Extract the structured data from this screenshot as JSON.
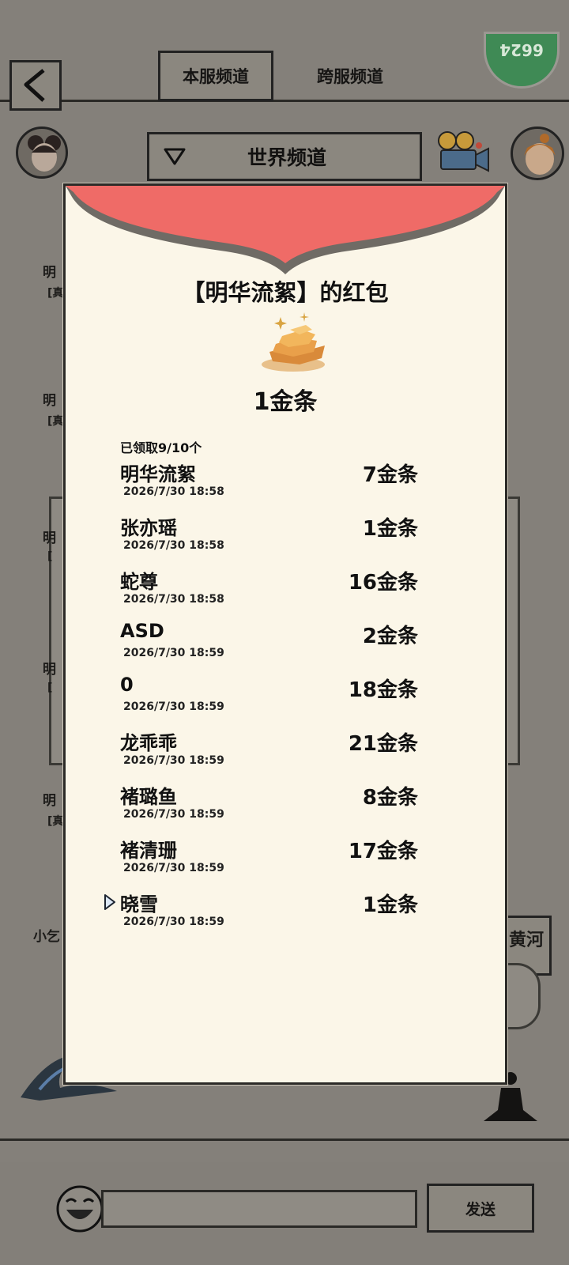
{
  "background_page": {
    "tabs": [
      "本服频道",
      "跨服频道"
    ],
    "channel_select": {
      "value": "世界频道"
    },
    "partial_names": [
      "明",
      "明",
      "明",
      "明",
      "明"
    ],
    "partial_subs": [
      "[真",
      "[真",
      "[",
      "[",
      "[真"
    ],
    "partial_user": "小乞",
    "right_box_text": "黄河",
    "send_label": "发送",
    "online_count": "6624"
  },
  "red_packet": {
    "title": "【明华流絮】的红包",
    "total_amount": "1金条",
    "claimed_status": "已领取9/10个",
    "claims": [
      {
        "name": "明华流絮",
        "time": "2026/7/30 18:58",
        "amount": "7金条"
      },
      {
        "name": "张亦瑶",
        "time": "2026/7/30 18:58",
        "amount": "1金条"
      },
      {
        "name": "蛇尊",
        "time": "2026/7/30 18:58",
        "amount": "16金条"
      },
      {
        "name": "ASD",
        "time": "2026/7/30 18:59",
        "amount": "2金条"
      },
      {
        "name": "0",
        "time": "2026/7/30 18:59",
        "amount": "18金条"
      },
      {
        "name": "龙乖乖",
        "time": "2026/7/30 18:59",
        "amount": "21金条"
      },
      {
        "name": "褚璐鱼",
        "time": "2026/7/30 18:59",
        "amount": "8金条"
      },
      {
        "name": "褚清珊",
        "time": "2026/7/30 18:59",
        "amount": "17金条"
      },
      {
        "name": "晓雪",
        "time": "2026/7/30 18:59",
        "amount": "1金条"
      }
    ]
  },
  "colors": {
    "packet_red": "#ef6b67",
    "packet_paper": "#fbf6e8",
    "overlay_bg": "#84807a",
    "online_green": "#3f8a55"
  },
  "icons": [
    "back-arrow-icon",
    "dropdown-triangle-icon",
    "camera-icon",
    "gold-bars-icon",
    "smile-icon",
    "self-marker-icon"
  ]
}
